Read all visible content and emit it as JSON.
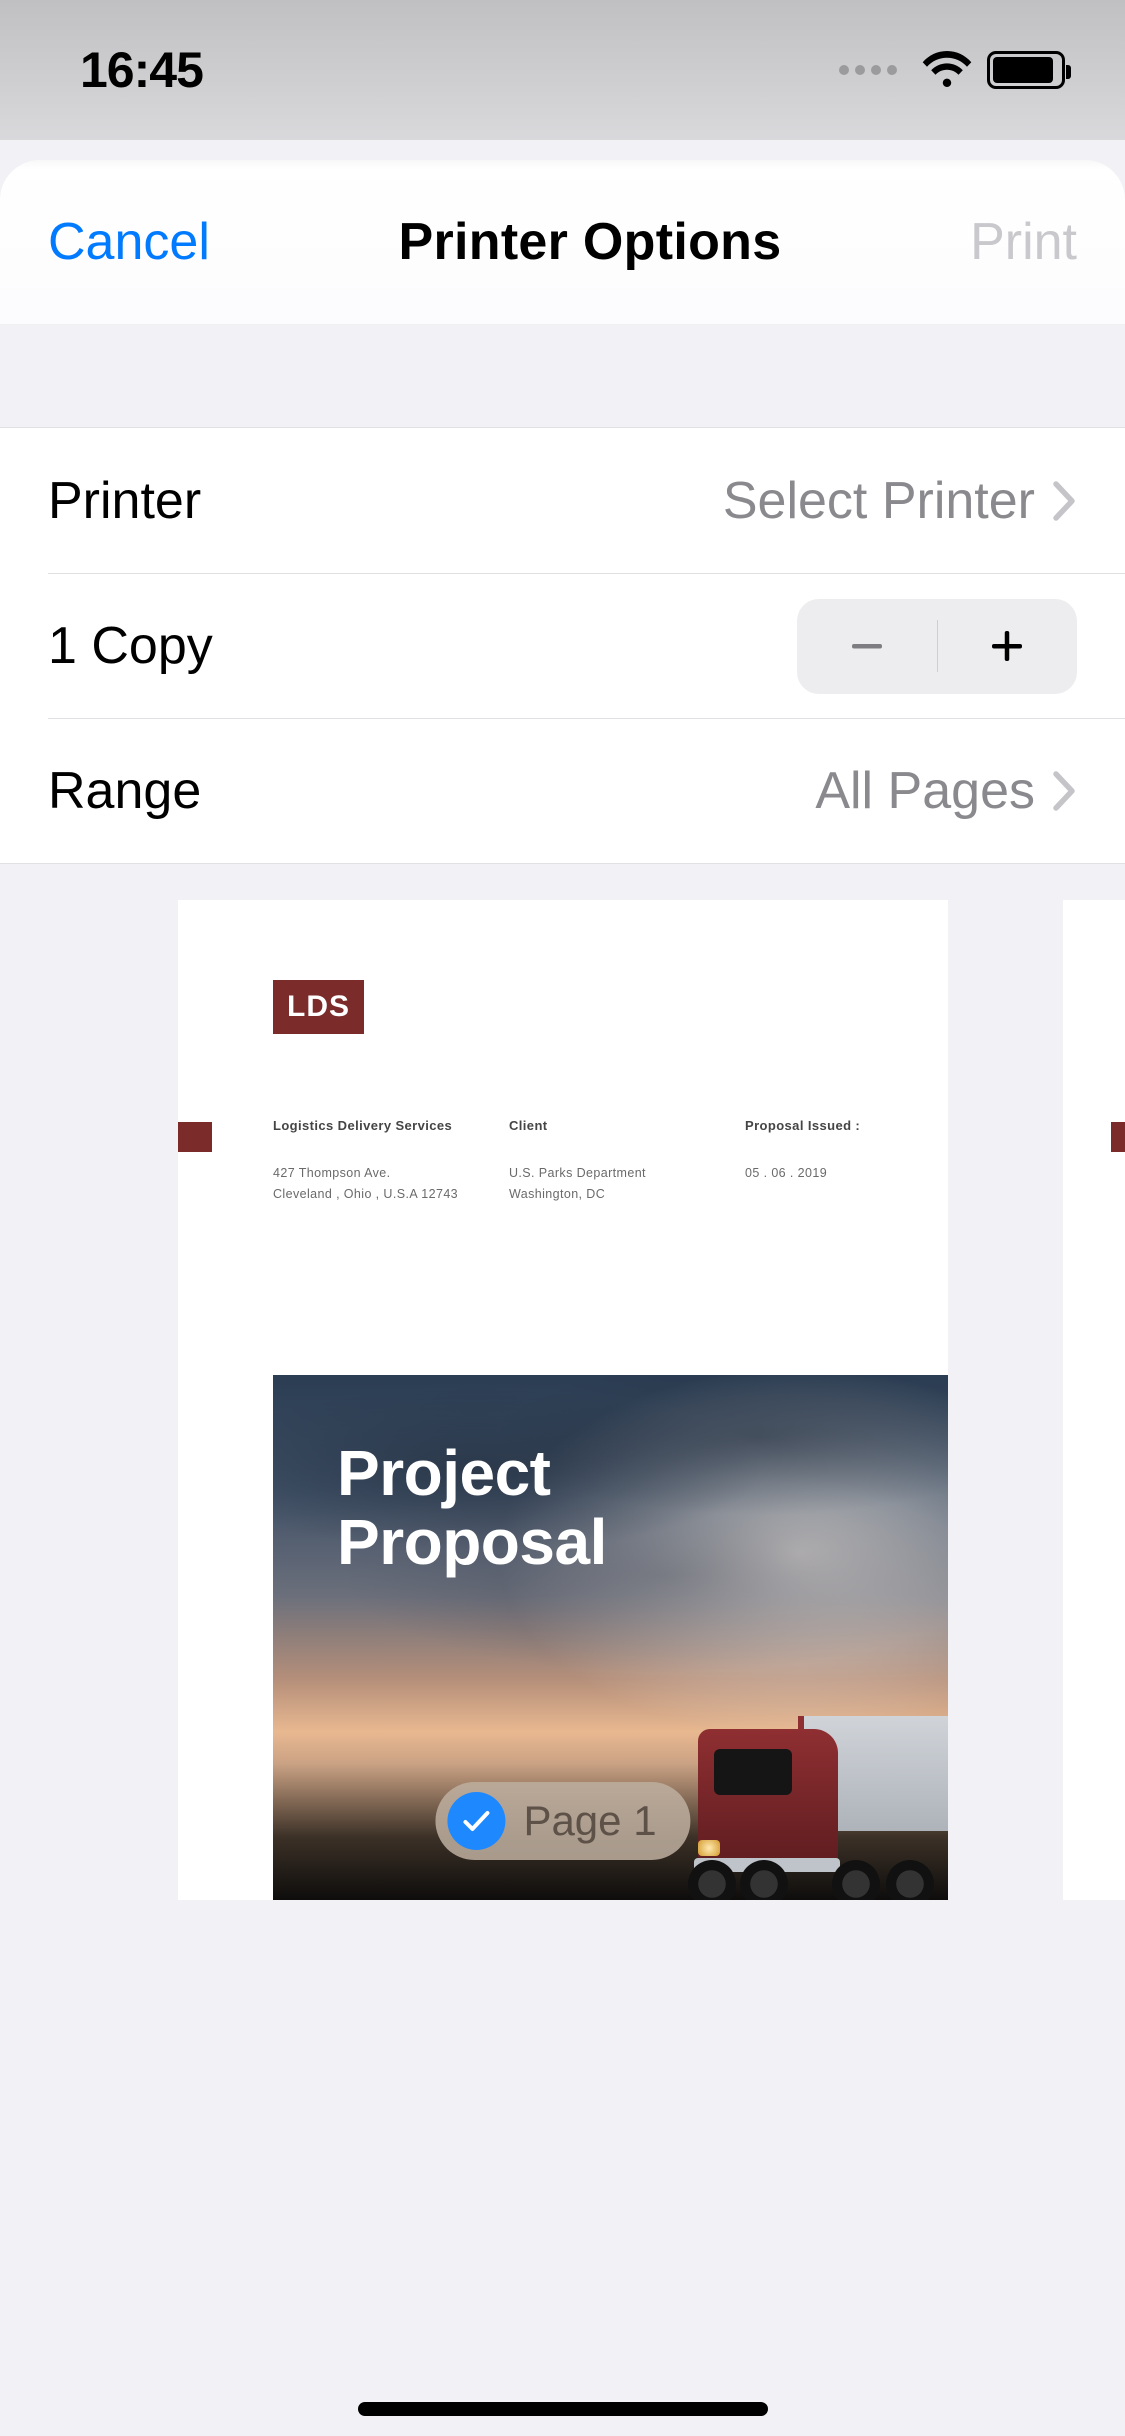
{
  "status": {
    "time": "16:45"
  },
  "nav": {
    "cancel": "Cancel",
    "title": "Printer Options",
    "print": "Print"
  },
  "rows": {
    "printer": {
      "label": "Printer",
      "value": "Select Printer"
    },
    "copies": {
      "label": "1 Copy"
    },
    "range": {
      "label": "Range",
      "value": "All Pages"
    }
  },
  "preview": {
    "logo": "LDS",
    "col1_head": "Logistics Delivery Services",
    "col1_l1": "427 Thompson Ave.",
    "col1_l2": "Cleveland , Ohio , U.S.A 12743",
    "col2_head": "Client",
    "col2_l1": "U.S. Parks Department",
    "col2_l2": "Washington, DC",
    "col3_head": "Proposal Issued :",
    "col3_l1": "05 . 06 . 2019",
    "title_l1": "Project",
    "title_l2": "Proposal",
    "page_label": "Page 1"
  },
  "colors": {
    "accent": "#007aff",
    "brand": "#7c2b2b"
  }
}
